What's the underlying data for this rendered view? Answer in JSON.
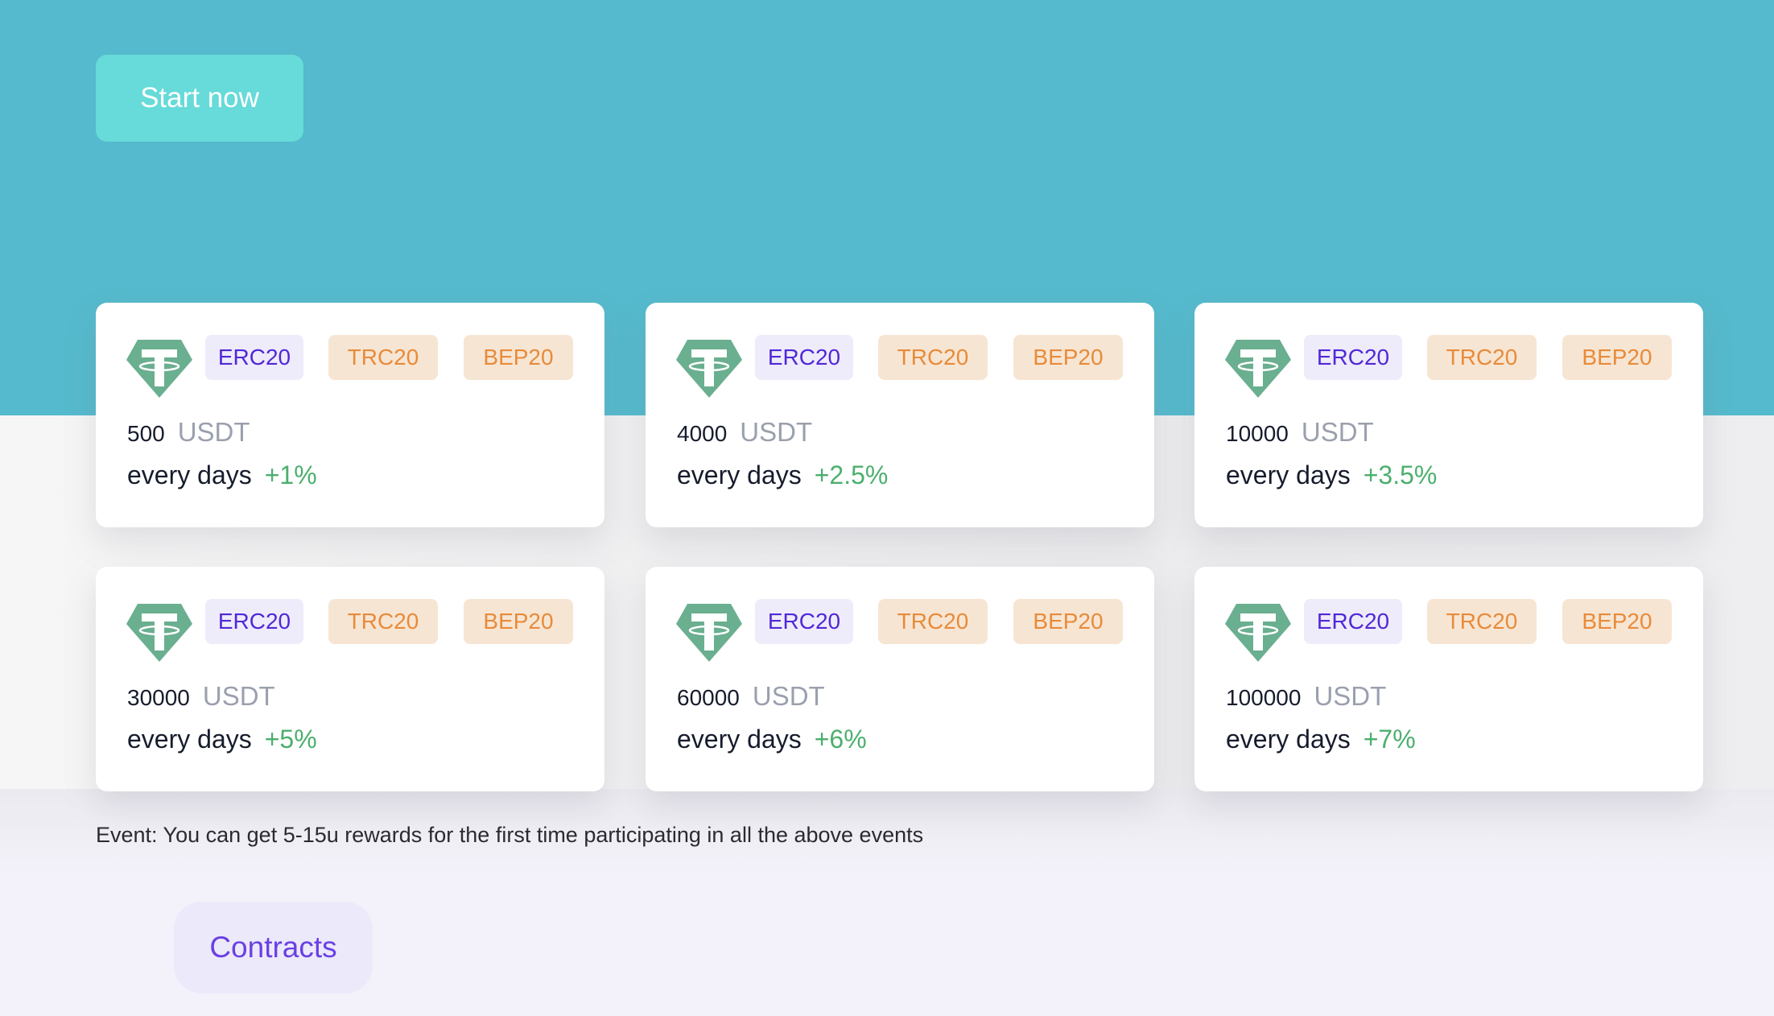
{
  "hero": {
    "start_label": "Start now"
  },
  "colors": {
    "hero_bg": "#55bacd",
    "start_btn": "#66dbd9",
    "erc": "#5128d6",
    "trc_bep": "#e88b3a",
    "gain": "#4caf6e",
    "contracts": "#6a40e3"
  },
  "plans": [
    {
      "icon": "tether-icon",
      "tags": [
        "ERC20",
        "TRC20",
        "BEP20"
      ],
      "amount": "500",
      "unit": "USDT",
      "period": "every days",
      "rate": "+1%"
    },
    {
      "icon": "tether-icon",
      "tags": [
        "ERC20",
        "TRC20",
        "BEP20"
      ],
      "amount": "4000",
      "unit": "USDT",
      "period": "every days",
      "rate": "+2.5%"
    },
    {
      "icon": "tether-icon",
      "tags": [
        "ERC20",
        "TRC20",
        "BEP20"
      ],
      "amount": "10000",
      "unit": "USDT",
      "period": "every days",
      "rate": "+3.5%"
    },
    {
      "icon": "tether-icon",
      "tags": [
        "ERC20",
        "TRC20",
        "BEP20"
      ],
      "amount": "30000",
      "unit": "USDT",
      "period": "every days",
      "rate": "+5%"
    },
    {
      "icon": "tether-icon",
      "tags": [
        "ERC20",
        "TRC20",
        "BEP20"
      ],
      "amount": "60000",
      "unit": "USDT",
      "period": "every days",
      "rate": "+6%"
    },
    {
      "icon": "tether-icon",
      "tags": [
        "ERC20",
        "TRC20",
        "BEP20"
      ],
      "amount": "100000",
      "unit": "USDT",
      "period": "every days",
      "rate": "+7%"
    }
  ],
  "event": {
    "text": "Event: You can get 5-15u rewards for the first time participating in all the above events"
  },
  "footer": {
    "contracts_label": "Contracts"
  }
}
